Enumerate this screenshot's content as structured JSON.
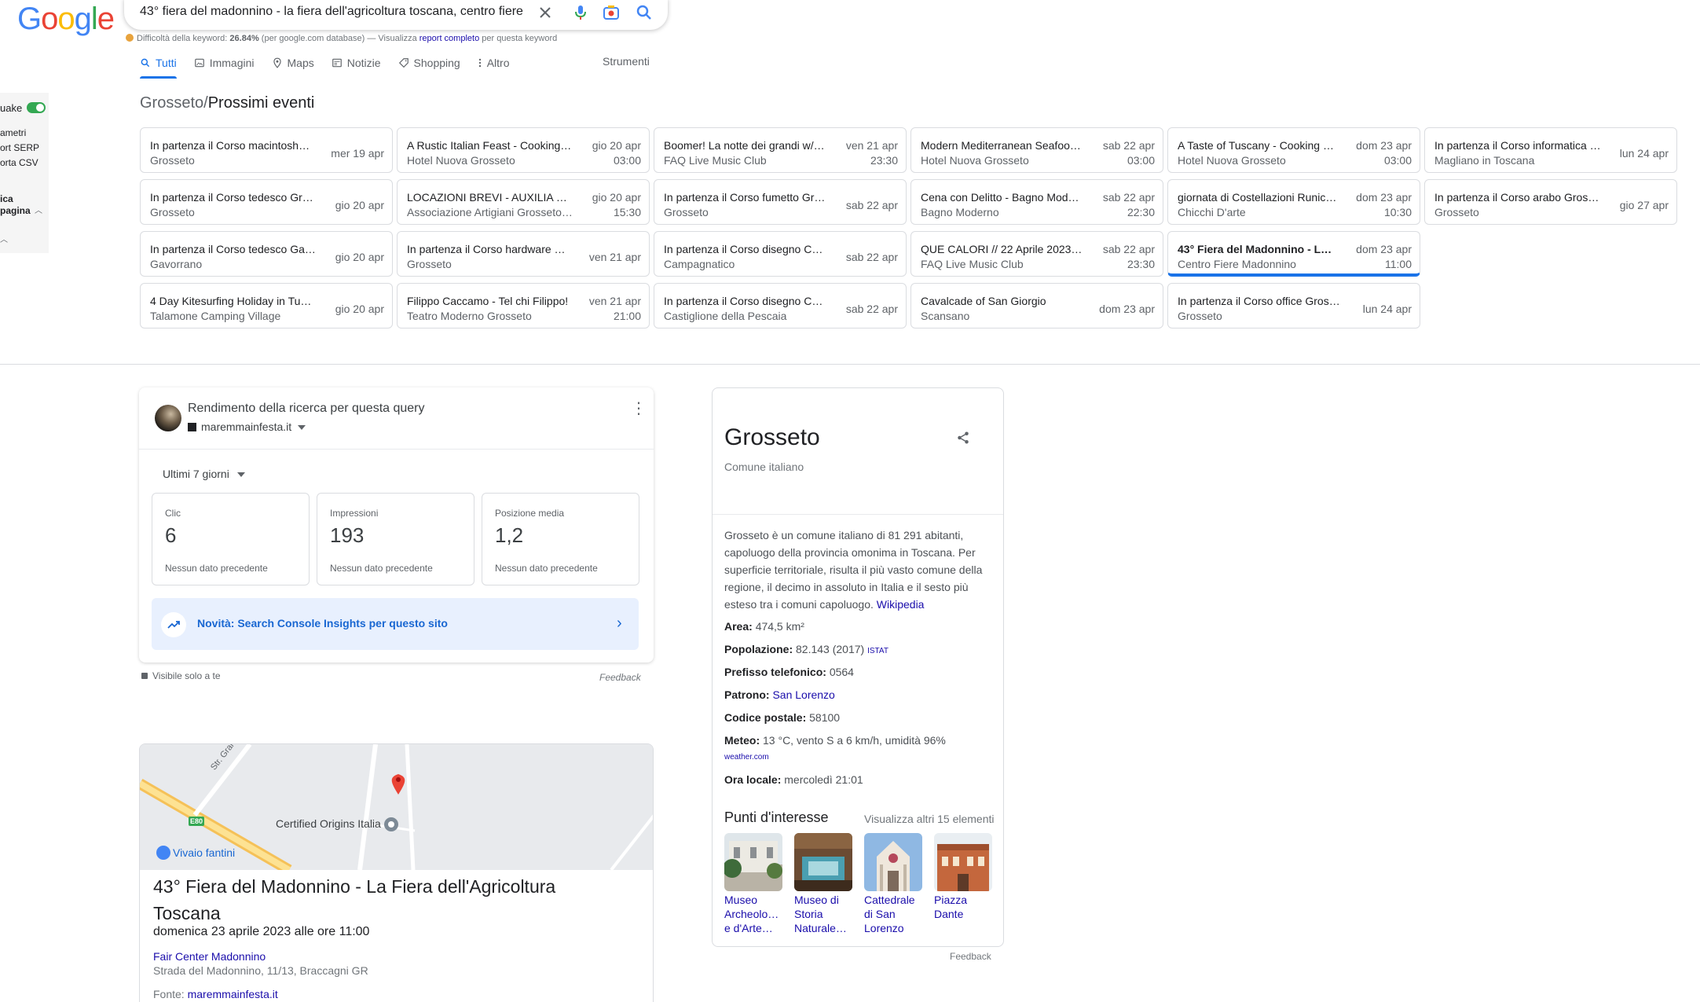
{
  "logo": "Google",
  "search": {
    "query": "43° fiera del madonnino - la fiera dell'agricoltura toscana, centro fiere"
  },
  "keyword_bar": {
    "label": "Difficoltà della keyword:",
    "value": "26.84%",
    "note": "(per google.com database) — Visualizza",
    "link": "report completo",
    "suffix": "per questa keyword"
  },
  "tabs": [
    {
      "label": "Tutti",
      "icon": "search-icon"
    },
    {
      "label": "Immagini",
      "icon": "image-icon"
    },
    {
      "label": "Maps",
      "icon": "map-pin-icon"
    },
    {
      "label": "Notizie",
      "icon": "news-icon"
    },
    {
      "label": "Shopping",
      "icon": "tag-icon"
    },
    {
      "label": "Altro",
      "icon": "more-vert-icon"
    }
  ],
  "tools_label": "Strumenti",
  "left_panel": {
    "items": [
      "uake",
      "ametri",
      "ort SERP",
      "orta CSV",
      "ica",
      "pagina"
    ]
  },
  "events": {
    "crumb": "Grosseto",
    "sep": "/",
    "title": "Prossimi eventi",
    "items": [
      {
        "name": "In partenza il Corso macintosh…",
        "place": "Grosseto",
        "date": "mer 19 apr",
        "time": ""
      },
      {
        "name": "A Rustic Italian Feast - Cooking…",
        "place": "Hotel Nuova Grosseto",
        "date": "gio 20 apr",
        "time": "03:00"
      },
      {
        "name": "Boomer! La notte dei grandi w/…",
        "place": "FAQ Live Music Club",
        "date": "ven 21 apr",
        "time": "23:30"
      },
      {
        "name": "Modern Mediterranean Seafoo…",
        "place": "Hotel Nuova Grosseto",
        "date": "sab 22 apr",
        "time": "03:00"
      },
      {
        "name": "A Taste of Tuscany - Cooking …",
        "place": "Hotel Nuova Grosseto",
        "date": "dom 23 apr",
        "time": "03:00"
      },
      {
        "name": "In partenza il Corso informatica …",
        "place": "Magliano in Toscana",
        "date": "lun 24 apr",
        "time": ""
      },
      {
        "name": "In partenza il Corso tedesco Gr…",
        "place": "Grosseto",
        "date": "gio 20 apr",
        "time": ""
      },
      {
        "name": "LOCAZIONI BREVI - AUXILIA …",
        "place": "Associazione Artigiani Grosseto…",
        "date": "gio 20 apr",
        "time": "15:30"
      },
      {
        "name": "In partenza il Corso fumetto Gr…",
        "place": "Grosseto",
        "date": "sab 22 apr",
        "time": ""
      },
      {
        "name": "Cena con Delitto - Bagno Mod…",
        "place": "Bagno Moderno",
        "date": "sab 22 apr",
        "time": "22:30"
      },
      {
        "name": "giornata di Costellazioni Runic…",
        "place": "Chicchi D'arte",
        "date": "dom 23 apr",
        "time": "10:30"
      },
      {
        "name": "In partenza il Corso arabo Gros…",
        "place": "Grosseto",
        "date": "gio 27 apr",
        "time": ""
      },
      {
        "name": "In partenza il Corso tedesco Ga…",
        "place": "Gavorrano",
        "date": "gio 20 apr",
        "time": ""
      },
      {
        "name": "In partenza il Corso hardware …",
        "place": "Grosseto",
        "date": "ven 21 apr",
        "time": ""
      },
      {
        "name": "In partenza il Corso disegno C…",
        "place": "Campagnatico",
        "date": "sab 22 apr",
        "time": ""
      },
      {
        "name": "QUE CALORI // 22 Aprile 2023…",
        "place": "FAQ Live Music Club",
        "date": "sab 22 apr",
        "time": "23:30"
      },
      {
        "name": "43° Fiera del Madonnino - L…",
        "place": "Centro Fiere Madonnino",
        "date": "dom 23 apr",
        "time": "11:00",
        "active": true
      },
      {
        "name": "4 Day Kitesurfing Holiday in Tu…",
        "place": "Talamone Camping Village",
        "date": "gio 20 apr",
        "time": ""
      },
      {
        "name": "Filippo Caccamo - Tel chi Filippo!",
        "place": "Teatro Moderno Grosseto",
        "date": "ven 21 apr",
        "time": "21:00"
      },
      {
        "name": "In partenza il Corso disegno C…",
        "place": "Castiglione della Pescaia",
        "date": "sab 22 apr",
        "time": ""
      },
      {
        "name": "Cavalcade of San Giorgio",
        "place": "Scansano",
        "date": "dom 23 apr",
        "time": ""
      },
      {
        "name": "In partenza il Corso office Gros…",
        "place": "Grosseto",
        "date": "lun 24 apr",
        "time": ""
      }
    ]
  },
  "search_console": {
    "title": "Rendimento della ricerca per questa query",
    "site": "maremmainfesta.it",
    "period": "Ultimi 7 giorni",
    "metrics": [
      {
        "label": "Clic",
        "value": "6",
        "note": "Nessun dato precedente"
      },
      {
        "label": "Impressioni",
        "value": "193",
        "note": "Nessun dato precedente"
      },
      {
        "label": "Posizione media",
        "value": "1,2",
        "note": "Nessun dato precedente"
      }
    ],
    "insights": "Novità: Search Console Insights per questo sito",
    "visible": "Visibile solo a te",
    "feedback": "Feedback"
  },
  "map": {
    "road_label": "Str. Grancia Sparapane",
    "route_badge": "E80",
    "place1": "Certified Origins Italia",
    "place2": "Vivaio fantini"
  },
  "event_detail": {
    "title": "43° Fiera del Madonnino - La Fiera dell'Agricoltura Toscana",
    "date": "domenica 23 aprile 2023 alle ore 11:00",
    "venue": "Fair Center Madonnino",
    "address": "Strada del Madonnino, 11/13, Braccagni GR",
    "source_label": "Fonte:",
    "source": "maremmainfesta.it"
  },
  "knowledge_panel": {
    "title": "Grosseto",
    "subtitle": "Comune italiano",
    "description": "Grosseto è un comune italiano di 81 291 abitanti, capoluogo della provincia omonima in Toscana. Per superficie territoriale, risulta il più vasto comune della regione, il decimo in assoluto in Italia e il sesto più esteso tra i comuni capoluogo.",
    "wiki": "Wikipedia",
    "facts": [
      {
        "label": "Area:",
        "value": "474,5 km²"
      },
      {
        "label": "Popolazione:",
        "value": "82.143 (2017)",
        "source": "ISTAT"
      },
      {
        "label": "Prefisso telefonico:",
        "value": "0564"
      },
      {
        "label": "Patrono:",
        "value": "San Lorenzo",
        "link": true
      },
      {
        "label": "Codice postale:",
        "value": "58100"
      },
      {
        "label": "Meteo:",
        "value": "13 °C, vento S a 6 km/h, umidità 96%",
        "source": "weather.com"
      },
      {
        "label": "Ora locale:",
        "value": "mercoledì 21:01"
      }
    ],
    "poi_title": "Punti d'interesse",
    "poi_more": "Visualizza altri 15 elementi",
    "pois": [
      {
        "name": "Museo Archeolo… e d'Arte…"
      },
      {
        "name": "Museo di Storia Naturale…"
      },
      {
        "name": "Cattedrale di San Lorenzo"
      },
      {
        "name": "Piazza Dante"
      }
    ],
    "feedback": "Feedback"
  },
  "colors": {
    "accent": "#1a73e8",
    "link": "#1a0dab",
    "border": "#dadce0"
  }
}
